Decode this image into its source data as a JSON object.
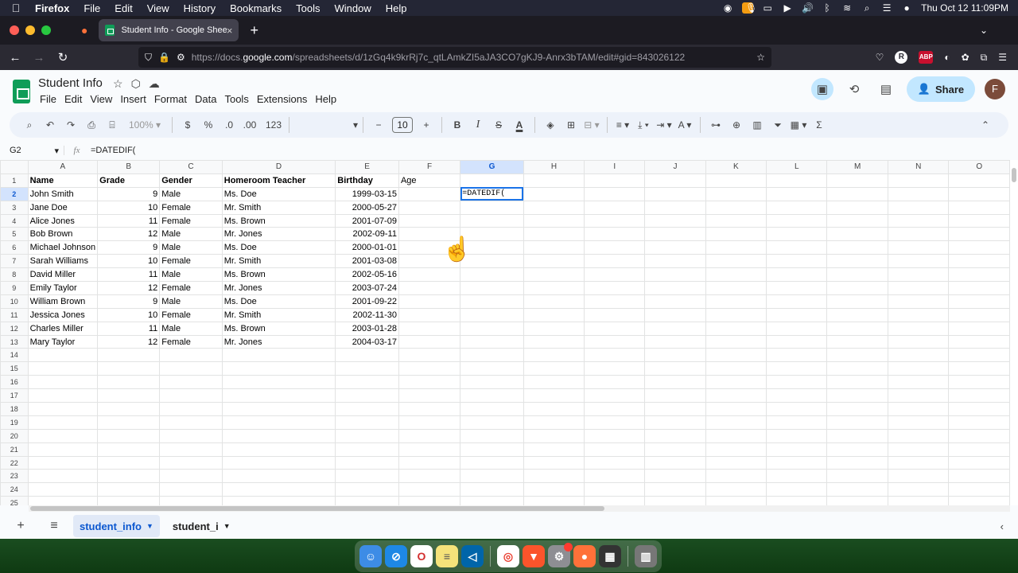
{
  "menubar": {
    "apple": "",
    "items": [
      "Firefox",
      "File",
      "Edit",
      "View",
      "History",
      "Bookmarks",
      "Tools",
      "Window",
      "Help"
    ],
    "clock": "Thu Oct 12  11:09PM"
  },
  "browser": {
    "tab_title": "Student Info - Google Sheets",
    "tab_close": "×",
    "new_tab": "+",
    "tabs_list": "⌄",
    "url_prefix": "https://docs.",
    "url_domain": "google.com",
    "url_rest": "/spreadsheets/d/1zGq4k9krRj7c_qtLAmkZI5aJA3CO7gKJ9-Anrx3bTAM/edit#gid=843026122",
    "ext_r": "R",
    "ext_abp": "ABP"
  },
  "sheets": {
    "doc_title": "Student Info",
    "menus": [
      "File",
      "Edit",
      "View",
      "Insert",
      "Format",
      "Data",
      "Tools",
      "Extensions",
      "Help"
    ],
    "share_label": "Share",
    "avatar_letter": "F",
    "toolbar": {
      "zoom": "100%",
      "currency": "$",
      "percent": "%",
      "dec_decrease": ".0",
      "dec_increase": ".00",
      "number_format": "123",
      "font_size": "10",
      "minus": "−",
      "plus": "+",
      "bold": "B",
      "italic": "I",
      "strike": "S",
      "text_color": "A",
      "sum": "Σ"
    },
    "name_box": "G2",
    "formula": "=DATEDIF(",
    "columns": [
      "A",
      "B",
      "C",
      "D",
      "E",
      "F",
      "G",
      "H",
      "I",
      "J",
      "K",
      "L",
      "M",
      "N",
      "O"
    ],
    "row_numbers": [
      "1",
      "2",
      "3",
      "4",
      "5",
      "6",
      "7",
      "8",
      "9",
      "10",
      "11",
      "12",
      "13",
      "14",
      "15",
      "16",
      "17",
      "18",
      "19",
      "20",
      "21",
      "22",
      "23",
      "24",
      "25"
    ],
    "headers": [
      "Name",
      "Grade",
      "Gender",
      "Homeroom Teacher",
      "Birthday",
      "Age"
    ],
    "rows": [
      [
        "John Smith",
        "9",
        "Male",
        "Ms. Doe",
        "1999-03-15"
      ],
      [
        "Jane Doe",
        "10",
        "Female",
        "Mr. Smith",
        "2000-05-27"
      ],
      [
        "Alice Jones",
        "11",
        "Female",
        "Ms. Brown",
        "2001-07-09"
      ],
      [
        "Bob Brown",
        "12",
        "Male",
        "Mr. Jones",
        "2002-09-11"
      ],
      [
        "Michael Johnson",
        "9",
        "Male",
        "Ms. Doe",
        "2000-01-01"
      ],
      [
        "Sarah Williams",
        "10",
        "Female",
        "Mr. Smith",
        "2001-03-08"
      ],
      [
        "David Miller",
        "11",
        "Male",
        "Ms. Brown",
        "2002-05-16"
      ],
      [
        "Emily Taylor",
        "12",
        "Female",
        "Mr. Jones",
        "2003-07-24"
      ],
      [
        "William Brown",
        "9",
        "Male",
        "Ms. Doe",
        "2001-09-22"
      ],
      [
        "Jessica Jones",
        "10",
        "Female",
        "Mr. Smith",
        "2002-11-30"
      ],
      [
        "Charles Miller",
        "11",
        "Male",
        "Ms. Brown",
        "2003-01-28"
      ],
      [
        "Mary Taylor",
        "12",
        "Female",
        "Mr. Jones",
        "2004-03-17"
      ]
    ],
    "active_cell_text": "=DATEDIF(",
    "sheet_tabs": [
      "student_info",
      "student_i"
    ],
    "colors": {
      "accent": "#0b57d0",
      "selection": "#1a73e8",
      "share_bg": "#c2e7ff"
    }
  }
}
